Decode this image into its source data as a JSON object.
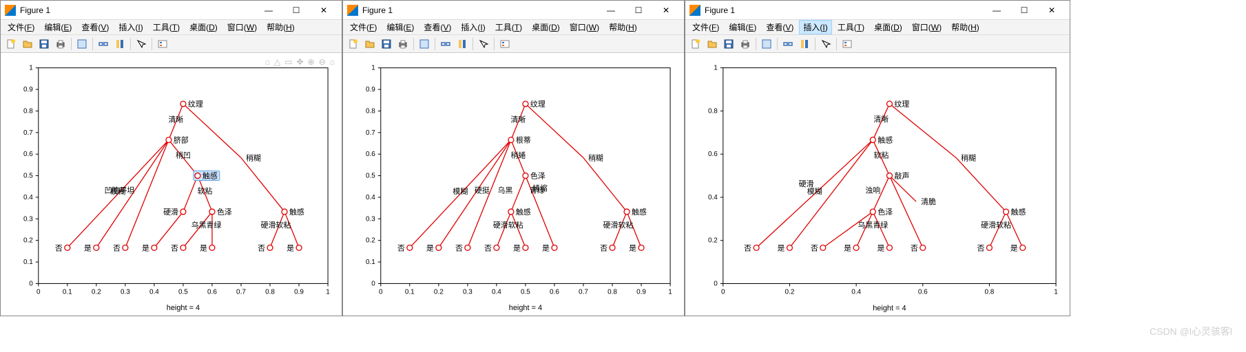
{
  "watermark": "CSDN @l心灵骇客l",
  "windows": [
    {
      "title": "Figure 1",
      "menu": [
        "文件(F)",
        "编辑(E)",
        "查看(V)",
        "插入(I)",
        "工具(T)",
        "桌面(D)",
        "窗口(W)",
        "帮助(H)"
      ],
      "highlight_menu": null,
      "xlabel": "height = 4",
      "show_mini_toolbar": true
    },
    {
      "title": "Figure 1",
      "menu": [
        "文件(F)",
        "编辑(E)",
        "查看(V)",
        "插入(I)",
        "工具(T)",
        "桌面(D)",
        "窗口(W)",
        "帮助(H)"
      ],
      "highlight_menu": null,
      "xlabel": "height = 4",
      "show_mini_toolbar": false
    },
    {
      "title": "Figure 1",
      "menu": [
        "文件(F)",
        "编辑(E)",
        "查看(V)",
        "插入(I)",
        "工具(T)",
        "桌面(D)",
        "窗口(W)",
        "帮助(H)"
      ],
      "highlight_menu": 3,
      "xlabel": "height = 4",
      "show_mini_toolbar": false
    }
  ],
  "toolbar_icons": [
    "new-file-icon",
    "open-folder-icon",
    "save-icon",
    "print-icon",
    "sep",
    "data-cursor-icon",
    "sep",
    "link-icon",
    "colorbar-icon",
    "sep",
    "arrow-icon",
    "sep",
    "legend-icon"
  ],
  "chart_data": [
    {
      "type": "tree",
      "xlim": [
        0,
        1
      ],
      "ylim": [
        0,
        1
      ],
      "xticks": [
        0,
        0.1,
        0.2,
        0.3,
        0.4,
        0.5,
        0.6,
        0.7,
        0.8,
        0.9,
        1
      ],
      "yticks": [
        0,
        0.1,
        0.2,
        0.3,
        0.4,
        0.5,
        0.6,
        0.7,
        0.8,
        0.9,
        1
      ],
      "xlabel": "height = 4",
      "highlighted_node": 6,
      "nodes": [
        {
          "id": 0,
          "x": 0.5,
          "y": 0.833,
          "label": "纹理",
          "side": "right"
        },
        {
          "id": 1,
          "x": 0.45,
          "y": 0.666,
          "label": "脐部",
          "side": "right",
          "edge_label": "清晰",
          "parent": 0
        },
        {
          "id": 2,
          "x": 0.1,
          "y": 0.166,
          "label": "否",
          "side": "left",
          "edge_label": "模糊",
          "parent": 1
        },
        {
          "id": 3,
          "x": 0.3,
          "y": 0.166,
          "label": "否",
          "side": "left",
          "edge_label": "凹陷平坦",
          "parent": 1,
          "via_label_x": 0.28,
          "via_label_y": 0.42
        },
        {
          "id": 4,
          "x": 0.2,
          "y": 0.166,
          "label": "是",
          "side": "left",
          "parent": 1
        },
        {
          "id": 5,
          "x": 0.7,
          "y": 0.583,
          "label": "稍糊",
          "side": "right",
          "parent": 0,
          "is_label": true
        },
        {
          "id": 6,
          "x": 0.55,
          "y": 0.5,
          "label": "触感",
          "side": "right",
          "edge_label": "稍凹",
          "parent": 1,
          "highlight": true
        },
        {
          "id": 7,
          "x": 0.5,
          "y": 0.333,
          "label": "硬滑",
          "side": "left",
          "parent": 6
        },
        {
          "id": 8,
          "x": 0.6,
          "y": 0.333,
          "label": "色泽",
          "side": "right",
          "edge_label": "软粘",
          "parent": 6
        },
        {
          "id": 9,
          "x": 0.4,
          "y": 0.166,
          "label": "是",
          "side": "left",
          "parent": 7
        },
        {
          "id": 10,
          "x": 0.5,
          "y": 0.166,
          "label": "否",
          "side": "left",
          "edge_label": "乌黑青绿",
          "parent": 8,
          "via_label_x": 0.58,
          "via_label_y": 0.26
        },
        {
          "id": 11,
          "x": 0.6,
          "y": 0.166,
          "label": "是",
          "side": "left",
          "parent": 8
        },
        {
          "id": 12,
          "x": 0.85,
          "y": 0.333,
          "label": "触感",
          "side": "right",
          "parent": 5
        },
        {
          "id": 13,
          "x": 0.8,
          "y": 0.166,
          "label": "否",
          "side": "left",
          "edge_label": "硬滑软粘",
          "parent": 12,
          "via_label_x": 0.82,
          "via_label_y": 0.26
        },
        {
          "id": 14,
          "x": 0.9,
          "y": 0.166,
          "label": "是",
          "side": "left",
          "parent": 12
        }
      ]
    },
    {
      "type": "tree",
      "xlim": [
        0,
        1
      ],
      "ylim": [
        0,
        1
      ],
      "xticks": [
        0,
        0.1,
        0.2,
        0.3,
        0.4,
        0.5,
        0.6,
        0.7,
        0.8,
        0.9,
        1
      ],
      "yticks": [
        0,
        0.1,
        0.2,
        0.3,
        0.4,
        0.5,
        0.6,
        0.7,
        0.8,
        0.9,
        1
      ],
      "xlabel": "height = 4",
      "nodes": [
        {
          "id": 0,
          "x": 0.5,
          "y": 0.833,
          "label": "纹理",
          "side": "right"
        },
        {
          "id": 1,
          "x": 0.45,
          "y": 0.666,
          "label": "根蒂",
          "side": "right",
          "edge_label": "清晰",
          "parent": 0
        },
        {
          "id": 2,
          "x": 0.1,
          "y": 0.166,
          "label": "否",
          "side": "left",
          "edge_label": "模糊",
          "parent": 1
        },
        {
          "id": 3,
          "x": 0.2,
          "y": 0.166,
          "label": "是",
          "side": "left",
          "parent": 1
        },
        {
          "id": 4,
          "x": 0.5,
          "y": 0.5,
          "label": "色泽",
          "side": "right",
          "edge_label": "稍蜷",
          "parent": 1
        },
        {
          "id": 5,
          "x": 0.7,
          "y": 0.583,
          "label": "稍糊",
          "side": "right",
          "parent": 0,
          "is_label": true,
          "via_label_x": 0.55,
          "via_label_y": 0.43,
          "edge_label": "蜷缩"
        },
        {
          "id": 6,
          "x": 0.3,
          "y": 0.166,
          "label": "否",
          "side": "left",
          "edge_label": "硬挺",
          "parent": 1,
          "via_label_x": 0.35,
          "via_label_y": 0.42
        },
        {
          "id": 7,
          "x": 0.45,
          "y": 0.333,
          "label": "触感",
          "side": "right",
          "edge_label": "乌黑",
          "parent": 4,
          "via_label_x": 0.43,
          "via_label_y": 0.42
        },
        {
          "id": 8,
          "x": 0.6,
          "y": 0.166,
          "label": "是",
          "side": "left",
          "edge_label": "青绿",
          "parent": 4,
          "via_label_x": 0.54,
          "via_label_y": 0.42
        },
        {
          "id": 9,
          "x": 0.4,
          "y": 0.166,
          "label": "否",
          "side": "left",
          "edge_label": "硬滑软粘",
          "parent": 7,
          "via_label_x": 0.44,
          "via_label_y": 0.26
        },
        {
          "id": 10,
          "x": 0.5,
          "y": 0.166,
          "label": "是",
          "side": "left",
          "parent": 7
        },
        {
          "id": 11,
          "x": 0.85,
          "y": 0.333,
          "label": "触感",
          "side": "right",
          "parent": 5
        },
        {
          "id": 12,
          "x": 0.8,
          "y": 0.166,
          "label": "否",
          "side": "left",
          "edge_label": "硬滑软粘",
          "parent": 11,
          "via_label_x": 0.82,
          "via_label_y": 0.26
        },
        {
          "id": 13,
          "x": 0.9,
          "y": 0.166,
          "label": "是",
          "side": "left",
          "parent": 11
        }
      ]
    },
    {
      "type": "tree",
      "xlim": [
        0,
        1
      ],
      "ylim": [
        0,
        1
      ],
      "xticks": [
        0,
        0.2,
        0.4,
        0.6,
        0.8,
        1
      ],
      "yticks": [
        0,
        0.2,
        0.4,
        0.6,
        0.8,
        1
      ],
      "xlabel": "height = 4",
      "nodes": [
        {
          "id": 0,
          "x": 0.5,
          "y": 0.833,
          "label": "纹理",
          "side": "right"
        },
        {
          "id": 1,
          "x": 0.45,
          "y": 0.666,
          "label": "触感",
          "side": "right",
          "edge_label": "清晰",
          "parent": 0
        },
        {
          "id": 2,
          "x": 0.1,
          "y": 0.166,
          "label": "否",
          "side": "left",
          "edge_label": "模糊",
          "parent": 1
        },
        {
          "id": 3,
          "x": 0.2,
          "y": 0.166,
          "label": "是",
          "side": "left",
          "edge_label": "硬滑",
          "parent": 1,
          "via_label_x": 0.25,
          "via_label_y": 0.45
        },
        {
          "id": 4,
          "x": 0.7,
          "y": 0.583,
          "label": "稍糊",
          "side": "right",
          "parent": 0,
          "is_label": true
        },
        {
          "id": 5,
          "x": 0.5,
          "y": 0.5,
          "label": "敲声",
          "side": "right",
          "edge_label": "软粘",
          "parent": 1
        },
        {
          "id": 6,
          "x": 0.45,
          "y": 0.333,
          "label": "色泽",
          "side": "right",
          "edge_label": "浊响",
          "parent": 5,
          "via_label_x": 0.45,
          "via_label_y": 0.42
        },
        {
          "id": 7,
          "x": 0.58,
          "y": 0.38,
          "label": "清脆",
          "side": "right",
          "parent": 5,
          "is_label": true
        },
        {
          "id": 8,
          "x": 0.3,
          "y": 0.166,
          "label": "否",
          "side": "left",
          "edge_label": "乌黑青绿",
          "parent": 6,
          "via_label_x": 0.45,
          "via_label_y": 0.26
        },
        {
          "id": 9,
          "x": 0.4,
          "y": 0.166,
          "label": "是",
          "side": "left",
          "parent": 6
        },
        {
          "id": 10,
          "x": 0.5,
          "y": 0.166,
          "label": "是",
          "side": "left",
          "parent": 6
        },
        {
          "id": 11,
          "x": 0.6,
          "y": 0.166,
          "label": "否",
          "side": "left",
          "parent": 5
        },
        {
          "id": 12,
          "x": 0.85,
          "y": 0.333,
          "label": "触感",
          "side": "right",
          "parent": 4
        },
        {
          "id": 13,
          "x": 0.8,
          "y": 0.166,
          "label": "否",
          "side": "left",
          "edge_label": "硬滑软粘",
          "parent": 12,
          "via_label_x": 0.82,
          "via_label_y": 0.26
        },
        {
          "id": 14,
          "x": 0.9,
          "y": 0.166,
          "label": "是",
          "side": "left",
          "parent": 12
        }
      ]
    }
  ]
}
